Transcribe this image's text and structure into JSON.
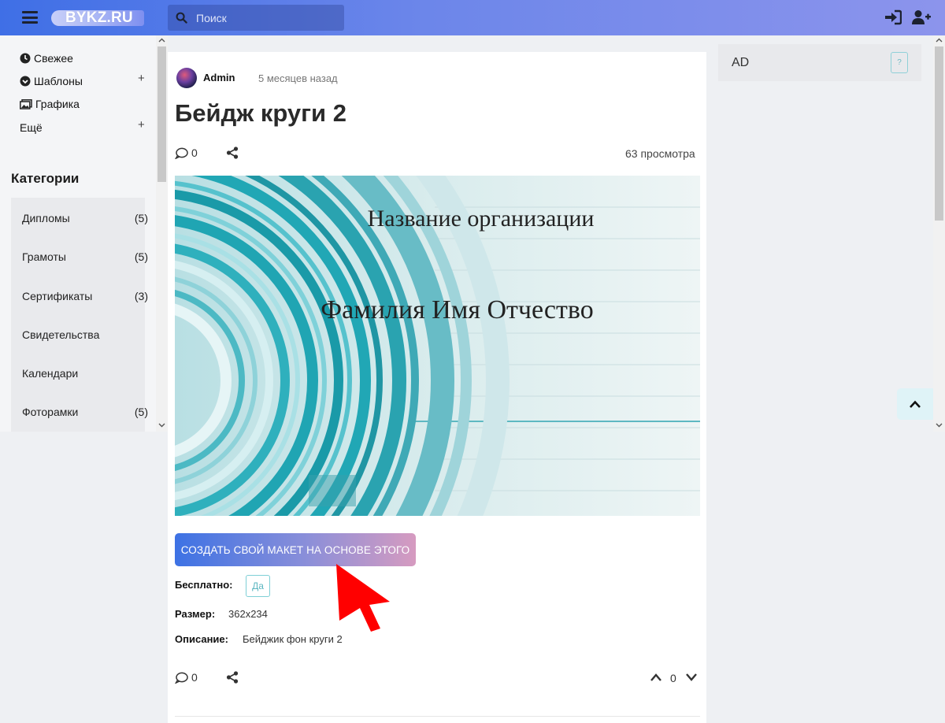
{
  "header": {
    "logo": "BYKZ.RU",
    "search_placeholder": "Поиск"
  },
  "sidebar": {
    "nav": [
      {
        "label": "Свежее",
        "icon": "clock-icon",
        "expandable": false
      },
      {
        "label": "Шаблоны",
        "icon": "chevron-circle-icon",
        "expandable": true
      },
      {
        "label": "Графика",
        "icon": "images-icon",
        "expandable": false
      },
      {
        "label": "Ещё",
        "icon": "",
        "expandable": true
      }
    ],
    "plus_symbol": "+",
    "categories_title": "Категории",
    "categories": [
      {
        "label": "Дипломы",
        "count": "(5)"
      },
      {
        "label": "Грамоты",
        "count": "(5)"
      },
      {
        "label": "Сертификаты",
        "count": "(3)"
      },
      {
        "label": "Свидетельства",
        "count": ""
      },
      {
        "label": "Календари",
        "count": ""
      },
      {
        "label": "Фоторамки",
        "count": "(5)"
      }
    ]
  },
  "post": {
    "author": "Admin",
    "time": "5 месяцев назад",
    "title": "Бейдж круги 2",
    "comments_top": "0",
    "views": "63 просмотра",
    "preview": {
      "org_text": "Название организации",
      "name_text": "Фамилия Имя Отчество"
    },
    "cta_label": "СОЗДАТЬ СВОЙ МАКЕТ НА ОСНОВЕ ЭТОГО",
    "fields": {
      "free_label": "Бесплатно:",
      "free_value": "Да",
      "size_label": "Размер:",
      "size_value": "362x234",
      "desc_label": "Описание:",
      "desc_value": "Бейджик фон круги 2"
    },
    "comments_bottom": "0",
    "votes": "0"
  },
  "right": {
    "ad_label": "AD",
    "ad_help": "?"
  },
  "colors": {
    "header_start": "#3f6fe6",
    "header_end": "#8c94ec",
    "accent_teal": "#5bb6c0",
    "cta_start": "#3d72e4",
    "cta_end": "#d69bc0",
    "arrow_red": "#ff0000"
  }
}
